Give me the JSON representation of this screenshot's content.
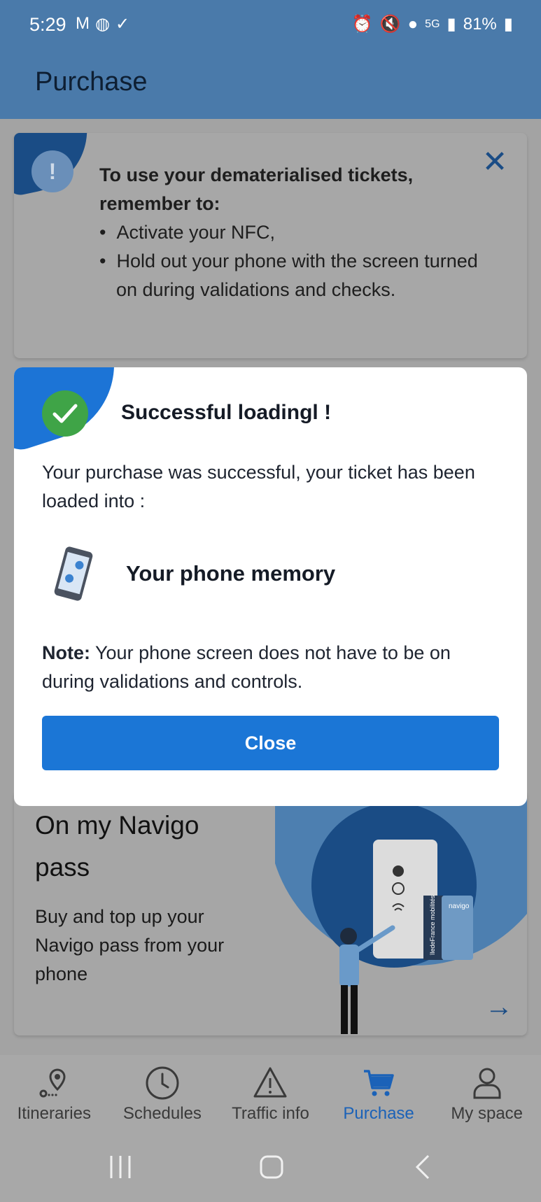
{
  "status_bar": {
    "time": "5:29",
    "left_icons": [
      "gmail-icon",
      "globe-icon",
      "volte-icon"
    ],
    "right_icons": [
      "alarm-icon",
      "mute-icon",
      "location-icon",
      "5g-icon",
      "signal-icon"
    ],
    "battery": "81%"
  },
  "header": {
    "title": "Purchase"
  },
  "info_card": {
    "heading": "To use your dematerialised tickets, remember to:",
    "bullets": [
      "Activate your NFC,",
      "Hold out your phone with the screen turned on during validations and checks."
    ],
    "bullet_char": "•",
    "warn_glyph": "!",
    "close_glyph": "✕"
  },
  "modal": {
    "title": "Successful loadingl !",
    "body": "Your purchase was successful, your ticket has been loaded into :",
    "destination": "Your phone memory",
    "note_label": "Note:",
    "note_text": " Your phone screen does not have to be on during validations and controls.",
    "close_label": "Close"
  },
  "navigo_card": {
    "title": "On my Navigo pass",
    "description": "Buy and top up your Navigo pass from your phone",
    "arrow": "→",
    "card_brand": "navigo",
    "card_logo": "îledeFrance mobilités"
  },
  "bottom_nav": {
    "items": [
      {
        "label": "Itineraries",
        "icon": "map-pin-icon"
      },
      {
        "label": "Schedules",
        "icon": "clock-icon"
      },
      {
        "label": "Traffic info",
        "icon": "warning-icon"
      },
      {
        "label": "Purchase",
        "icon": "cart-icon",
        "active": true
      },
      {
        "label": "My space",
        "icon": "user-icon"
      }
    ]
  },
  "colors": {
    "header": "#4a7aaa",
    "primary": "#1b76d6",
    "success": "#3fa447",
    "active_nav": "#1b62b8"
  }
}
